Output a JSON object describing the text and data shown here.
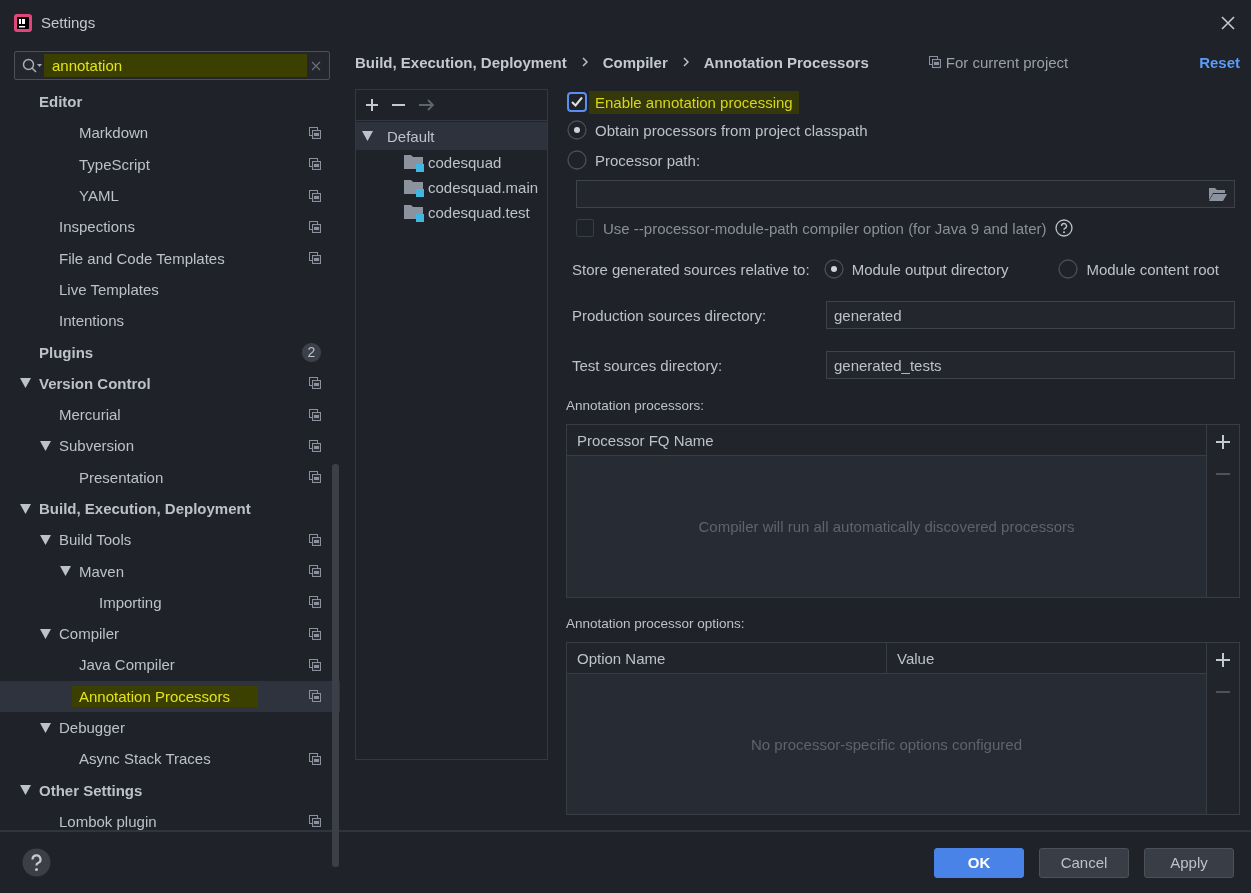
{
  "window": {
    "title": "Settings"
  },
  "search": {
    "value": "annotation",
    "highlighted": true
  },
  "sidebar": {
    "items": [
      {
        "label": "Editor",
        "children": [
          {
            "children": [
              {
                "label": "Markdown",
                "project_scope": true,
                "selected": false
              },
              {
                "label": "TypeScript",
                "project_scope": true,
                "selected": false
              },
              {
                "label": "YAML",
                "project_scope": true,
                "selected": false
              }
            ]
          },
          {
            "label": "Inspections",
            "project_scope": true,
            "selected": false
          },
          {
            "label": "File and Code Templates",
            "project_scope": true,
            "selected": false
          },
          {
            "label": "Live Templates",
            "project_scope": false,
            "selected": false
          },
          {
            "label": "Intentions",
            "project_scope": false,
            "selected": false
          }
        ],
        "selected": false
      },
      {
        "label": "Plugins",
        "badge": "2",
        "selected": false
      },
      {
        "label": "Version Control",
        "expanded": true,
        "project_scope": true,
        "selected": false,
        "children": [
          {
            "label": "Mercurial",
            "project_scope": true,
            "selected": false
          },
          {
            "label": "Subversion",
            "expanded": true,
            "project_scope": true,
            "selected": false,
            "children": [
              {
                "label": "Presentation",
                "project_scope": true,
                "selected": false
              }
            ]
          }
        ]
      },
      {
        "label": "Build, Execution, Deployment",
        "expanded": true,
        "selected": false,
        "children": [
          {
            "label": "Build Tools",
            "expanded": true,
            "project_scope": true,
            "selected": false,
            "children": [
              {
                "label": "Maven",
                "expanded": true,
                "project_scope": true,
                "selected": false,
                "children": [
                  {
                    "label": "Importing",
                    "project_scope": true,
                    "selected": false
                  }
                ]
              }
            ]
          },
          {
            "label": "Compiler",
            "expanded": true,
            "project_scope": true,
            "selected": false,
            "children": [
              {
                "label": "Java Compiler",
                "project_scope": true,
                "selected": false
              },
              {
                "label": "Annotation Processors",
                "project_scope": true,
                "selected": true,
                "highlighted": true
              }
            ]
          },
          {
            "label": "Debugger",
            "expanded": true,
            "selected": false,
            "children": [
              {
                "label": "Async Stack Traces",
                "project_scope": true,
                "selected": false
              }
            ]
          }
        ]
      },
      {
        "label": "Other Settings",
        "expanded": true,
        "selected": false,
        "children": [
          {
            "label": "Lombok plugin",
            "project_scope": true,
            "selected": false
          }
        ]
      }
    ]
  },
  "breadcrumb": [
    "Build, Execution, Deployment",
    "Compiler",
    "Annotation Processors"
  ],
  "scope_note": "For current project",
  "reset": "Reset",
  "profiles": {
    "items": [
      {
        "label": "Default",
        "expanded": true,
        "selected": true,
        "children": [
          {
            "label": "codesquad",
            "selected": false
          },
          {
            "label": "codesquad.main",
            "selected": false
          },
          {
            "label": "codesquad.test",
            "selected": false
          }
        ]
      }
    ]
  },
  "options": {
    "enable": {
      "label": "Enable annotation processing",
      "checked": true,
      "highlighted": true
    },
    "source_radios": [
      {
        "label": "Obtain processors from project classpath",
        "selected": true
      },
      {
        "label": "Processor path:",
        "selected": false
      }
    ],
    "module_path": {
      "label": "Use --processor-module-path compiler option (for Java 9 and later)",
      "checked": false,
      "disabled": true
    },
    "store_label": "Store generated sources relative to:",
    "store_radios": [
      {
        "label": "Module output directory",
        "selected": true
      },
      {
        "label": "Module content root",
        "selected": false
      }
    ],
    "fields": [
      {
        "label": "Production sources directory:",
        "value": "generated"
      },
      {
        "label": "Test sources directory:",
        "value": "generated_tests"
      }
    ]
  },
  "processors": {
    "title": "Annotation processors:",
    "columns": [
      "Processor FQ Name"
    ],
    "empty": "Compiler will run all automatically discovered processors"
  },
  "processor_options": {
    "title": "Annotation processor options:",
    "columns": [
      "Option Name",
      "Value"
    ],
    "empty": "No processor-specific options configured"
  },
  "buttons": [
    {
      "label": "OK",
      "kind": "primary"
    },
    {
      "label": "Cancel",
      "kind": "normal"
    },
    {
      "label": "Apply",
      "kind": "normal"
    }
  ]
}
